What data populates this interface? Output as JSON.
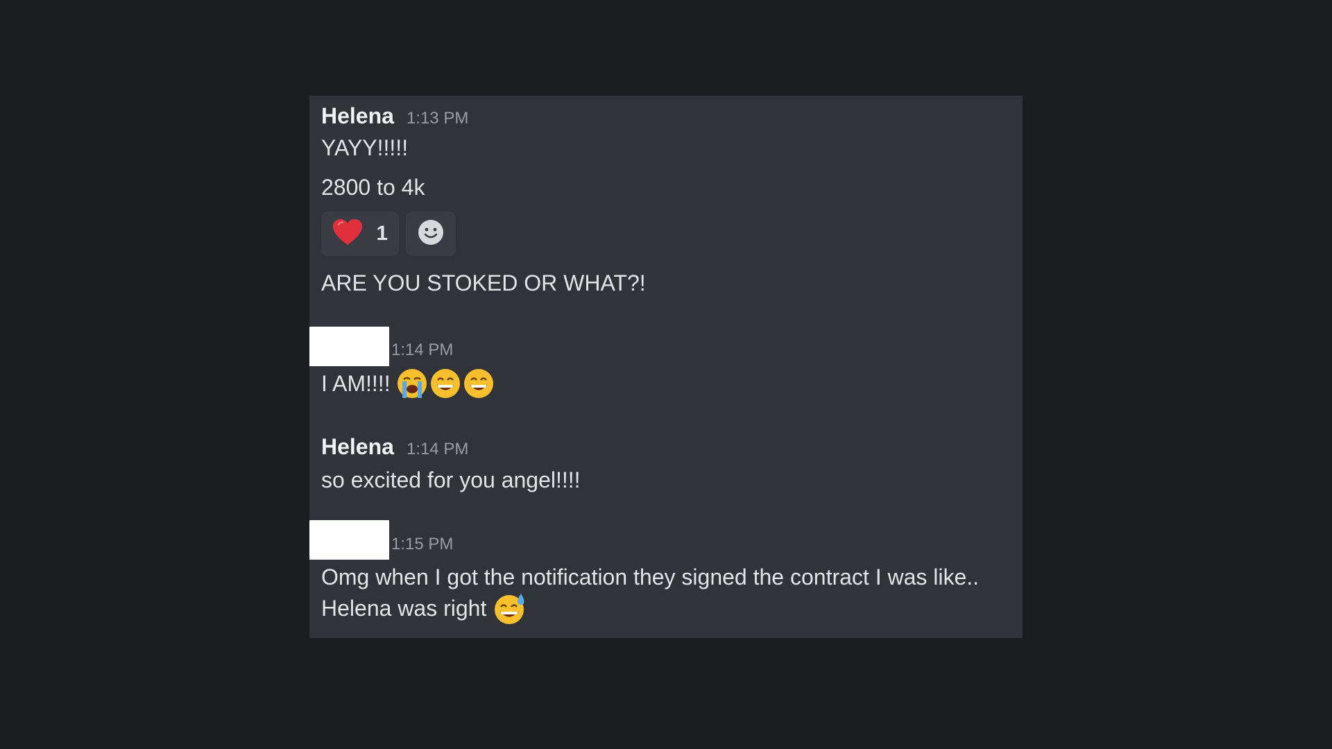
{
  "messages": [
    {
      "author": "Helena",
      "time": "1:13 PM",
      "lines": [
        "YAYY!!!!!",
        "2800 to 4k"
      ],
      "reactions": [
        {
          "emoji": "red-heart-icon",
          "count": "1"
        },
        {
          "emoji": "add-reaction-smiley-icon"
        }
      ],
      "after_reaction": "ARE YOU STOKED OR WHAT?!"
    },
    {
      "author": "",
      "author_redacted": true,
      "time": "1:14 PM",
      "text": "I AM!!!!",
      "emojis": [
        "loudly-crying-face-icon",
        "grinning-face-icon",
        "grinning-face-icon"
      ]
    },
    {
      "author": "Helena",
      "time": "1:14 PM",
      "text": "so excited for you angel!!!!"
    },
    {
      "author": "",
      "author_redacted": true,
      "time": "1:15 PM",
      "lines": [
        "Omg when I got the notification they signed the contract I was like..",
        "Helena was right"
      ],
      "emojis": [
        "grinning-sweat-face-icon"
      ]
    }
  ],
  "colors": {
    "background": "#1c1d21",
    "panel": "#313338",
    "reaction_bg": "#3a3c43",
    "heart": "#e0303c",
    "emoji_yellow": "#f7c02c"
  }
}
